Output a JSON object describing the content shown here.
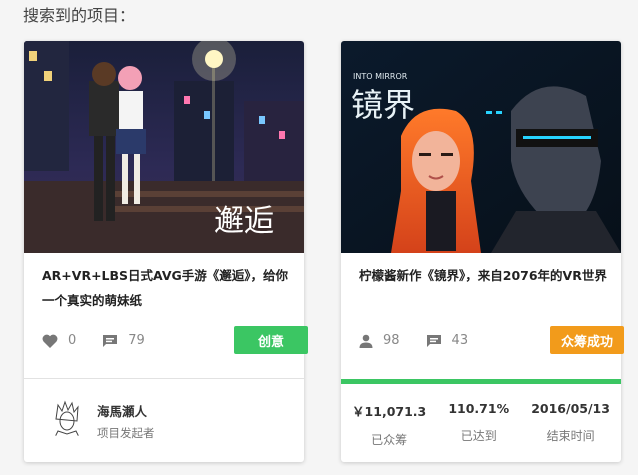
{
  "heading": "搜索到的项目：",
  "colors": {
    "green": "#3bc663",
    "orange": "#f29b1b"
  },
  "projects": [
    {
      "cover_title": "邂逅",
      "title": "AR+VR+LBS日式AVG手游《邂逅》，给你一个真实的萌妹纸",
      "likes_icon": "heart-icon",
      "likes": "0",
      "comments_icon": "comment-icon",
      "comments": "79",
      "tag": "创意",
      "creator": {
        "name": "海馬瀬人",
        "role": "项目发起者"
      }
    },
    {
      "cover_subtitle": "INTO MIRROR",
      "cover_title": "镜界",
      "title": "柠檬酱新作《镜界》，来自2076年的VR世界",
      "backers_icon": "user-icon",
      "backers": "98",
      "comments_icon": "comment-icon",
      "comments": "43",
      "tag": "众筹成功",
      "progress_fraction": 1.0,
      "raised": "￥11,071.3",
      "raised_label": "已众筹",
      "percent": "110.71%",
      "percent_label": "已达到",
      "end_date": "2016/05/13",
      "end_label": "结束时间"
    }
  ]
}
